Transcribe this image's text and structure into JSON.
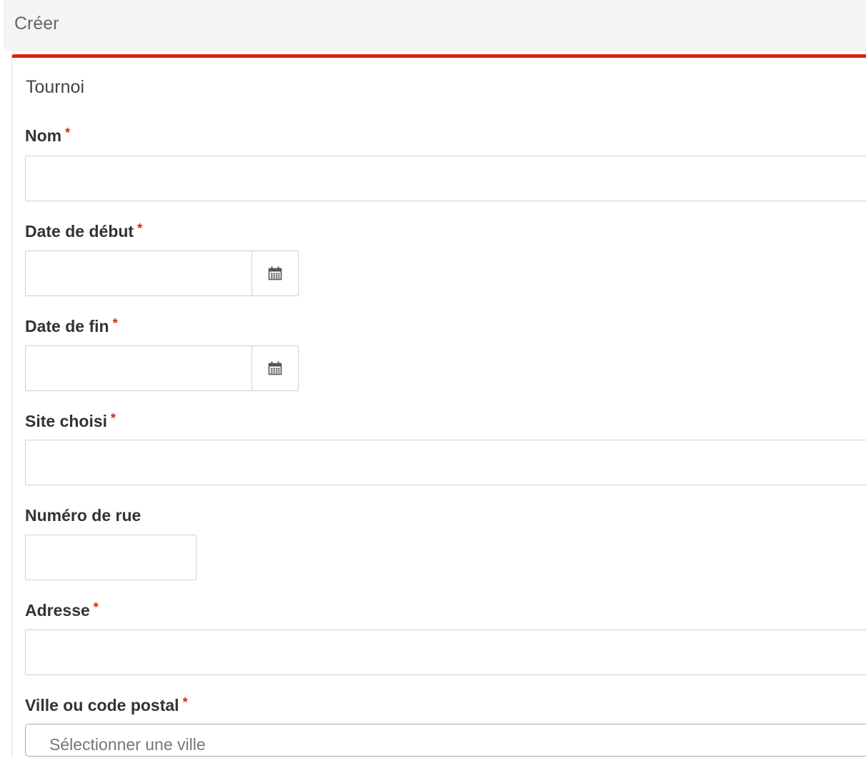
{
  "header": {
    "title": "Créer"
  },
  "panel": {
    "title": "Tournoi",
    "accent_color": "#d9260f"
  },
  "form": {
    "required_marker": "*",
    "nom": {
      "label": "Nom",
      "value": ""
    },
    "date_debut": {
      "label": "Date de début",
      "value": "",
      "icon": "calendar-icon"
    },
    "date_fin": {
      "label": "Date de fin",
      "value": "",
      "icon": "calendar-icon"
    },
    "site_choisi": {
      "label": "Site choisi",
      "value": ""
    },
    "numero_rue": {
      "label": "Numéro de rue",
      "value": ""
    },
    "adresse": {
      "label": "Adresse",
      "value": ""
    },
    "ville": {
      "label": "Ville ou code postal",
      "placeholder": "Sélectionner une ville"
    }
  }
}
